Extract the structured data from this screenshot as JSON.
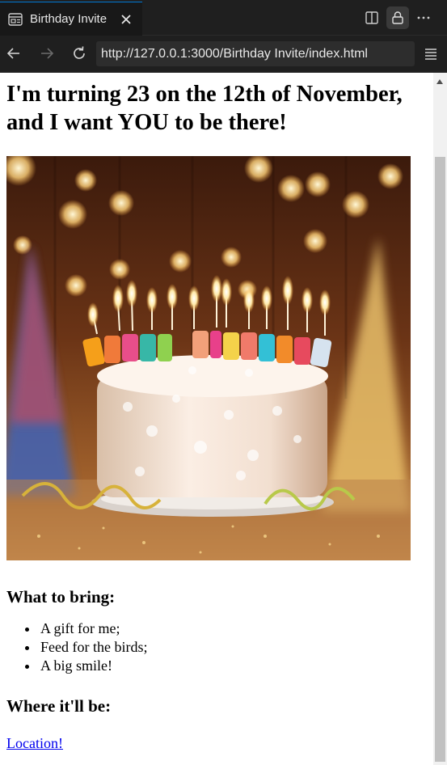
{
  "browser": {
    "tab_title": "Birthday Invite",
    "url": "http://127.0.0.1:3000/Birthday Invite/index.html",
    "icons": {
      "tab": "browser-page-icon",
      "close": "close-icon",
      "split": "split-editor-icon",
      "lock": "lock-icon",
      "more": "more-icon",
      "back": "back-arrow-icon",
      "forward": "forward-arrow-icon",
      "reload": "reload-icon",
      "menu": "hamburger-menu-icon"
    },
    "colors": {
      "chrome_bg": "#1f1f1f",
      "accent": "#0078d4"
    }
  },
  "page": {
    "heading": "I'm turning 23 on the 12th of November, and I want YOU to be there!",
    "image_subject": "birthday-cake-with-candles",
    "cake_candle_text": "HAPPY BIRTHDAY",
    "bring_heading": "What to bring:",
    "bring_items": [
      "A gift for me;",
      "Feed for the birds;",
      "A big smile!"
    ],
    "where_heading": "Where it'll be:",
    "location_link": "Location!",
    "link_color": "#0000ee"
  }
}
